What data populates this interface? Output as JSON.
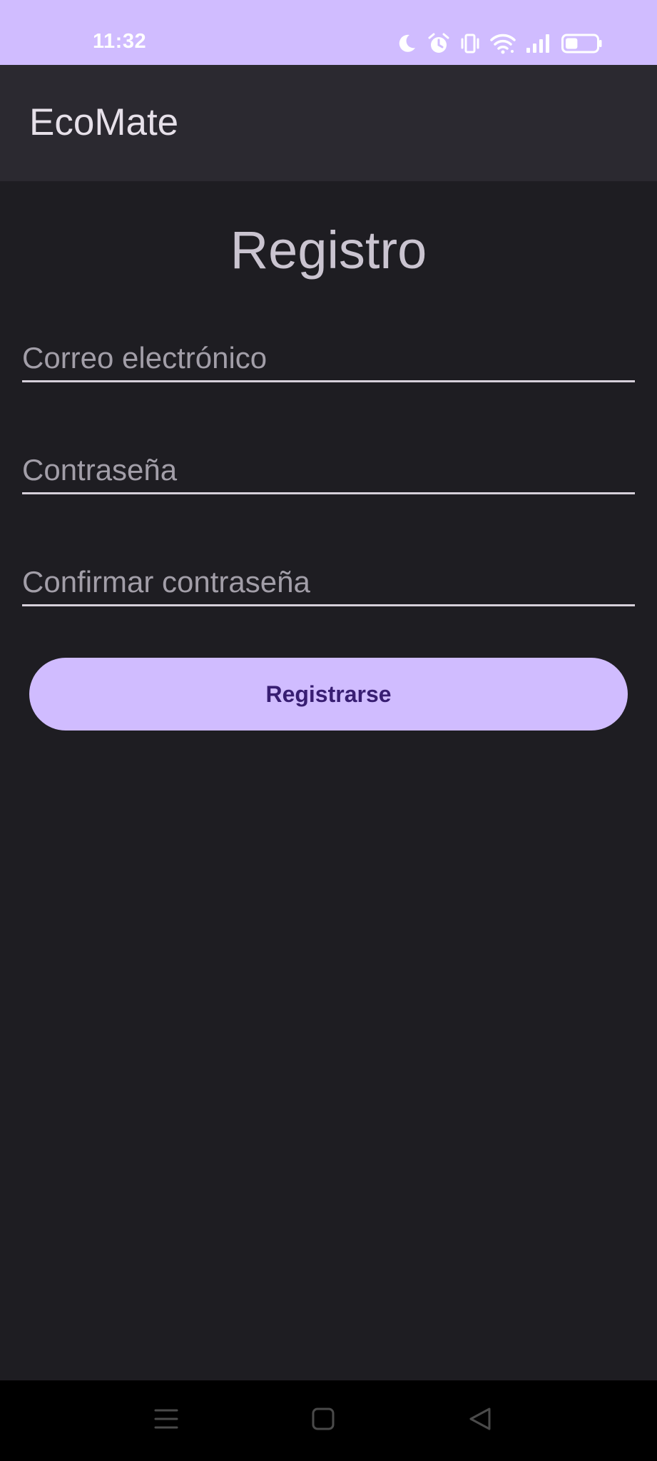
{
  "status_bar": {
    "time": "11:32",
    "icons": [
      "moon-icon",
      "alarm-icon",
      "vibrate-icon",
      "wifi-icon",
      "signal-icon",
      "battery-icon"
    ],
    "battery_level": 0.4,
    "background_color": "#d0bcff"
  },
  "app_bar": {
    "title": "EcoMate",
    "background_color": "#2b2930"
  },
  "form": {
    "title": "Registro",
    "email_placeholder": "Correo electrónico",
    "email_value": "",
    "password_placeholder": "Contraseña",
    "password_value": "",
    "confirm_placeholder": "Confirmar contraseña",
    "confirm_value": "",
    "submit_label": "Registrarse",
    "accent_color": "#d0bcff",
    "button_text_color": "#381e72"
  },
  "nav_bar": {
    "buttons": [
      "menu-icon",
      "home-icon",
      "back-icon"
    ]
  }
}
